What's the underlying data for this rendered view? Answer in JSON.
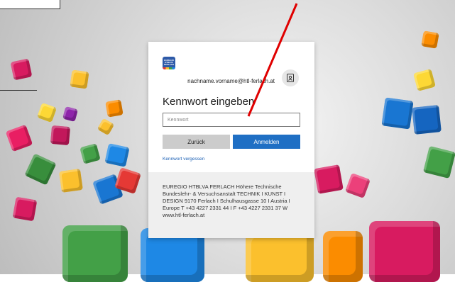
{
  "login": {
    "identity": "nachname.vorname@htl-ferlach.at",
    "title": "Kennwort eingeben",
    "password_placeholder": "Kennwort",
    "back_label": "Zurück",
    "signin_label": "Anmelden",
    "forgot_label": "Kennwort vergessen",
    "footer_text": "EUREGIO HTBLVA FERLACH Höhere Technische Bundeslehr- & Versuchsanstalt TECHNIK I KUNST I DESIGN 9170 Ferlach I Schulhausgasse 10 I Austria I Europe T +43 4227 2331 44 I F +43 4227 2331 37 W www.htl-ferlach.at",
    "logo_text": "EUREGIO HTBLVA FERLACH"
  },
  "colors": {
    "primary": "#1f6fc4",
    "link": "#1a5fb4",
    "annotation_arrow": "#e00000"
  },
  "icons": {
    "account": "key-user-icon",
    "logo": "school-logo-icon"
  }
}
